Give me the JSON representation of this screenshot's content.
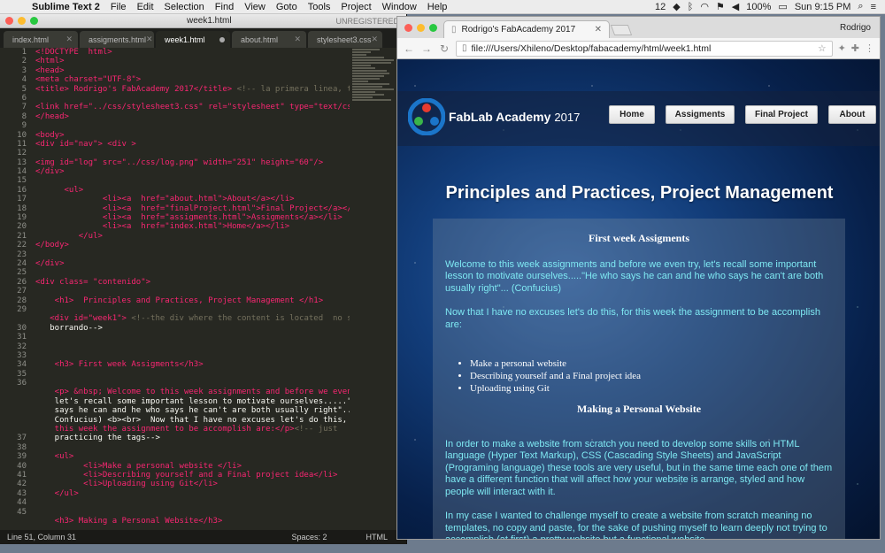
{
  "menubar": {
    "app_name": "Sublime Text 2",
    "items": [
      "File",
      "Edit",
      "Selection",
      "Find",
      "View",
      "Goto",
      "Tools",
      "Project",
      "Window",
      "Help"
    ],
    "notification_count": "12",
    "battery": "100%",
    "clock": "Sun 9:15 PM"
  },
  "sublime": {
    "title": "week1.html",
    "unregistered": "UNREGISTERED",
    "tabs": [
      {
        "label": "index.html"
      },
      {
        "label": "assigments.html"
      },
      {
        "label": "week1.html"
      },
      {
        "label": "about.html"
      },
      {
        "label": "stylesheet3.css"
      }
    ],
    "line_numbers": [
      "1",
      "2",
      "3",
      "4",
      "5",
      "6",
      "7",
      "8",
      "9",
      "10",
      "11",
      "12",
      "13",
      "14",
      "15",
      "16",
      "17",
      "18",
      "19",
      "20",
      "21",
      "22",
      "23",
      "24",
      "25",
      "26",
      "27",
      "28",
      "29",
      "",
      "30",
      "31",
      "32",
      "33",
      "34",
      "35",
      "36",
      "",
      "",
      "",
      "",
      "",
      "37",
      "38",
      "39",
      "40",
      "41",
      "42",
      "43",
      "44",
      "45"
    ],
    "code": [
      "<!DOCTYPE  html>",
      "<html>",
      "<head>",
      "<meta charset=\"UTF-8\">",
      "<title> Rodrigo's FabAcademy 2017</title> <!-- la primera linea, titulo-->",
      "",
      "<link href=\"../css/stylesheet3.css\" rel=\"stylesheet\" type=\"text/css\">",
      "</head>",
      "",
      "<body>",
      "<div id=\"nav\"> <div >",
      "",
      "<img id=\"log\" src=\"../css/log.png\" width=\"251\" height=\"60\"/>",
      "</div>",
      "",
      "      <ul>",
      "              <li><a  href=\"about.html\">About</a></li>",
      "              <li><a  href=\"finalProject.html\">Final Project</a></li>",
      "              <li><a  href=\"assigments.html\">Assigments</a></li>",
      "              <li><a  href=\"index.html\">Home</a></li>",
      "         </ul>",
      "</body>",
      "",
      "</div>",
      "",
      "<div class= \"contenido\">",
      "",
      "    <h1>  Principles and Practices, Project Management </h1>",
      "",
      "   <div id=\"week1\"> <!--the div where the content is located  no sigas",
      "   borrando-->",
      "",
      "",
      "",
      "    <h3> First week Assigments</h3>",
      "",
      "",
      "    <p> &nbsp; Welcome to this week assignments and before we even try,",
      "    let's recall some important lesson to motivate ourselves.....\"He who",
      "    says he can and he who says he can't are both usually right\"... (",
      "    Confucius) <b><br>  Now that I have no excuses let's do this, for",
      "    this week the assignment to be accomplish are:</p><!-- just",
      "    practicing the tags-->",
      "",
      "    <ul>",
      "          <li>Make a personal website </li>",
      "          <li>Describing yourself and a Final project idea</li>",
      "          <li>Uploading using Git</li>",
      "    </ul>",
      "",
      "",
      "    <h3> Making a Personal Website</h3>"
    ],
    "status": {
      "position": "Line 51, Column 31",
      "spaces": "Spaces: 2",
      "syntax": "HTML"
    }
  },
  "chrome": {
    "tab_title": "Rodrigo's FabAcademy 2017",
    "user": "Rodrigo",
    "url": "file:///Users/Xhileno/Desktop/fabacademy/html/week1.html"
  },
  "site": {
    "logo_text": "FabLab Academy",
    "logo_year": "2017",
    "nav": [
      "Home",
      "Assigments",
      "Final Project",
      "About"
    ],
    "h1": "Principles and Practices, Project Management",
    "h3_first": "First week Assigments",
    "p1": "  Welcome to this week assignments and before we even try, let's recall some important lesson to motivate ourselves.....\"He who says he can and he who says he can't are both usually right\"... (Confucius)",
    "p2": "Now that I have no excuses let's do this, for this week the assignment to be accomplish are:",
    "list": [
      "Make a personal website",
      "Describing yourself and a Final project idea",
      "Uploading using Git"
    ],
    "h3_second": "Making a Personal Website",
    "p3": "  In order to make a website from scratch you need to develop some skills on HTML language (Hyper Text Markup), CSS (Cascading Style Sheets) and JavaScript (Programing language) these tools are very useful, but in the same time each one of them have a different function that will affect how your website is arrange, styled and how people will interact with it.",
    "p4": "In my case I wanted to challenge myself to create a website from scratch meaning no templates, no copy and paste, for the sake of pushing myself to learn deeply not trying to accomplish (at first) a pretty website but a functional website."
  }
}
